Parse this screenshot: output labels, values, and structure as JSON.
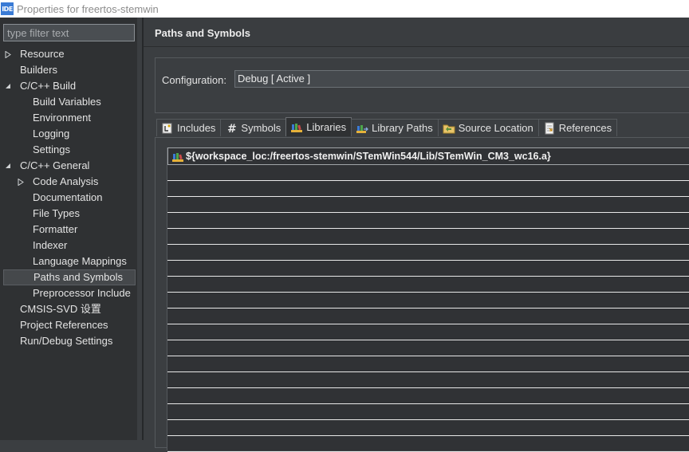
{
  "window": {
    "icon_text": "IDE",
    "title": "Properties for freertos-stemwin"
  },
  "filter": {
    "placeholder": "type filter text"
  },
  "tree": [
    {
      "label": "Resource",
      "level": 0,
      "twisty": "collapsed"
    },
    {
      "label": "Builders",
      "level": 0,
      "twisty": "none"
    },
    {
      "label": "C/C++ Build",
      "level": 0,
      "twisty": "expanded"
    },
    {
      "label": "Build Variables",
      "level": 1,
      "twisty": "none"
    },
    {
      "label": "Environment",
      "level": 1,
      "twisty": "none"
    },
    {
      "label": "Logging",
      "level": 1,
      "twisty": "none"
    },
    {
      "label": "Settings",
      "level": 1,
      "twisty": "none"
    },
    {
      "label": "C/C++ General",
      "level": 0,
      "twisty": "expanded"
    },
    {
      "label": "Code Analysis",
      "level": 1,
      "twisty": "collapsed"
    },
    {
      "label": "Documentation",
      "level": 1,
      "twisty": "none"
    },
    {
      "label": "File Types",
      "level": 1,
      "twisty": "none"
    },
    {
      "label": "Formatter",
      "level": 1,
      "twisty": "none"
    },
    {
      "label": "Indexer",
      "level": 1,
      "twisty": "none"
    },
    {
      "label": "Language Mappings",
      "level": 1,
      "twisty": "none"
    },
    {
      "label": "Paths and Symbols",
      "level": 1,
      "twisty": "none",
      "selected": true
    },
    {
      "label": "Preprocessor Include",
      "level": 1,
      "twisty": "none"
    },
    {
      "label": "CMSIS-SVD 设置",
      "level": 0,
      "twisty": "none"
    },
    {
      "label": "Project References",
      "level": 0,
      "twisty": "none"
    },
    {
      "label": "Run/Debug Settings",
      "level": 0,
      "twisty": "none"
    }
  ],
  "page": {
    "title": "Paths and Symbols",
    "configuration_label": "Configuration:",
    "configuration_value": "Debug  [ Active ]"
  },
  "tabs": [
    {
      "label": "Includes",
      "icon": "includes-icon"
    },
    {
      "label": "Symbols",
      "icon": "hash-icon"
    },
    {
      "label": "Libraries",
      "icon": "library-icon",
      "active": true
    },
    {
      "label": "Library Paths",
      "icon": "library-path-icon"
    },
    {
      "label": "Source Location",
      "icon": "folder-icon"
    },
    {
      "label": "References",
      "icon": "references-icon"
    }
  ],
  "libraries": [
    "${workspace_loc:/freertos-stemwin/STemWin544/Lib/STemWin_CM3_wc16.a}"
  ],
  "colors": {
    "background": "#3b3e41",
    "tree_background": "#2f3133",
    "list_grid": "#e8e8e8"
  }
}
